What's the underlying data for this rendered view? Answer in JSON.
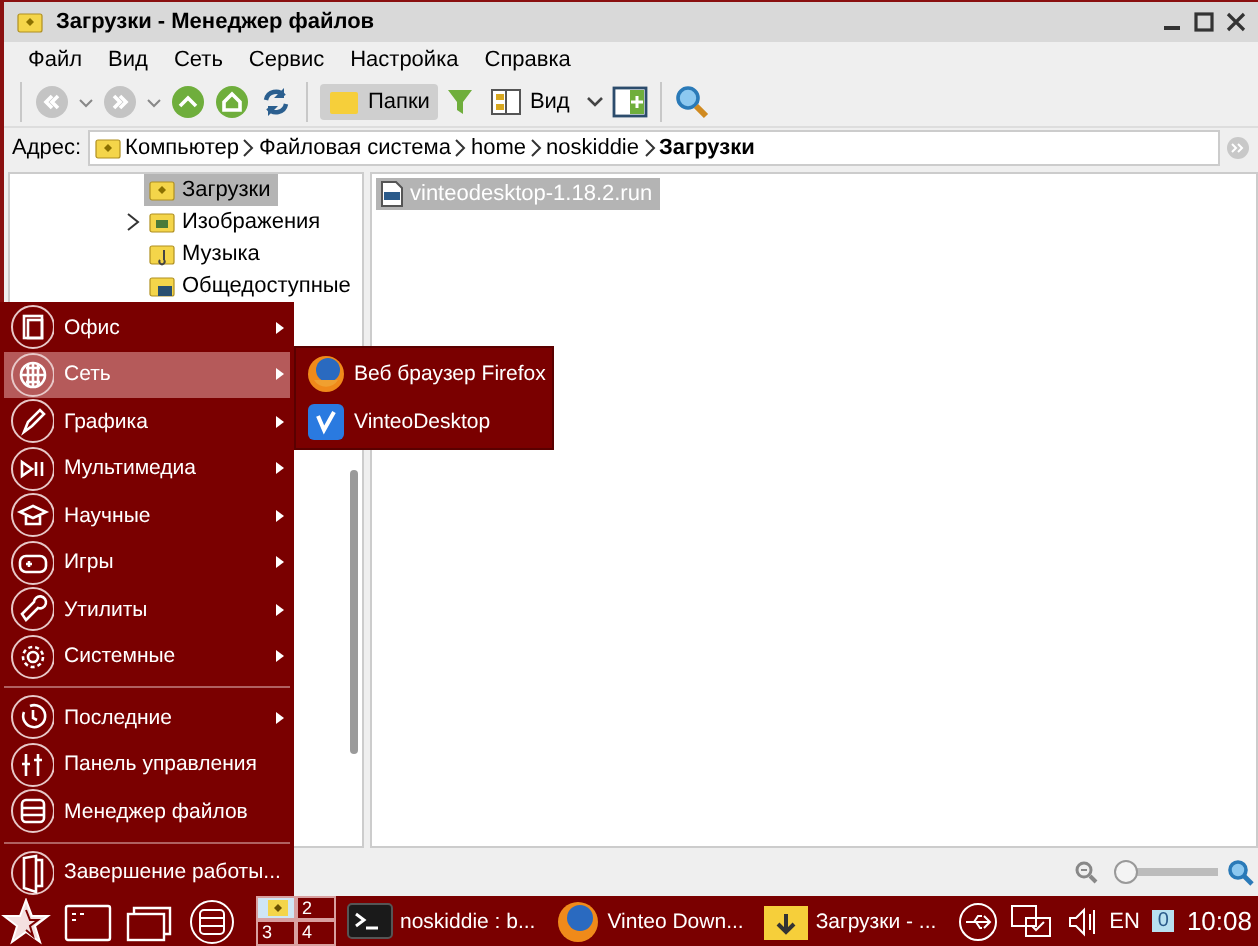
{
  "window": {
    "title": "Загрузки - Менеджер файлов"
  },
  "menubar": [
    "Файл",
    "Вид",
    "Сеть",
    "Сервис",
    "Настройка",
    "Справка"
  ],
  "toolbar": {
    "folders_button": {
      "label": "Папки",
      "selected": true
    },
    "view_button": {
      "label": "Вид"
    }
  },
  "address": {
    "label": "Адрес:",
    "crumbs": [
      {
        "label": "Компьютер",
        "current": false
      },
      {
        "label": "Файловая система",
        "current": false
      },
      {
        "label": "home",
        "current": false
      },
      {
        "label": "noskiddie",
        "current": false
      },
      {
        "label": "Загрузки",
        "current": true
      }
    ]
  },
  "tree": [
    {
      "label": "Загрузки",
      "selected": true,
      "expandable": false
    },
    {
      "label": "Изображения",
      "selected": false,
      "expandable": true
    },
    {
      "label": "Музыка",
      "selected": false,
      "expandable": false
    },
    {
      "label": "Общедоступные",
      "selected": false,
      "expandable": false
    }
  ],
  "files": [
    {
      "name": "vinteodesktop-1.18.2.run",
      "selected": true
    }
  ],
  "status_bar": {
    "zoom": {
      "level": 0.1
    }
  },
  "start_menu": {
    "groups": [
      [
        {
          "label": "Офис",
          "submenu": true,
          "selected": false
        },
        {
          "label": "Сеть",
          "submenu": true,
          "selected": true
        },
        {
          "label": "Графика",
          "submenu": true,
          "selected": false
        },
        {
          "label": "Мультимедиа",
          "submenu": true,
          "selected": false
        },
        {
          "label": "Научные",
          "submenu": true,
          "selected": false
        },
        {
          "label": "Игры",
          "submenu": true,
          "selected": false
        },
        {
          "label": "Утилиты",
          "submenu": true,
          "selected": false
        },
        {
          "label": "Системные",
          "submenu": true,
          "selected": false
        }
      ],
      [
        {
          "label": "Последние",
          "submenu": true,
          "selected": false
        },
        {
          "label": "Панель управления",
          "submenu": false,
          "selected": false
        },
        {
          "label": "Менеджер файлов",
          "submenu": false,
          "selected": false
        }
      ],
      [
        {
          "label": "Завершение работы...",
          "submenu": false,
          "selected": false
        }
      ]
    ],
    "submenu": [
      "Веб браузер Firefox",
      "VinteoDesktop"
    ]
  },
  "taskbar": {
    "pager": [
      "2",
      "3",
      "4"
    ],
    "tasks": [
      {
        "label": "noskiddie : b..."
      },
      {
        "label": "Vinteo Down..."
      },
      {
        "label": "Загрузки - ..."
      }
    ],
    "keyboard_layout": "EN",
    "notifications": "0",
    "clock": "10:08"
  }
}
